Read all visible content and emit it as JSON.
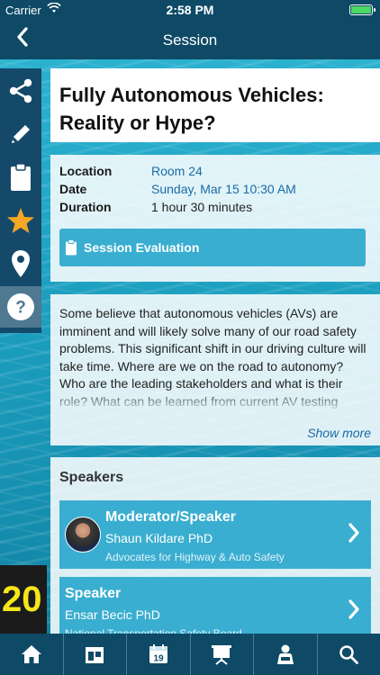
{
  "status_bar": {
    "carrier": "Carrier",
    "time": "2:58 PM"
  },
  "nav": {
    "title": "Session",
    "back_icon": "chevron-left-icon"
  },
  "sidebar": {
    "items": [
      {
        "icon": "share-icon"
      },
      {
        "icon": "pencil-icon"
      },
      {
        "icon": "clipboard-icon"
      },
      {
        "icon": "star-icon",
        "color": "#f5a623"
      },
      {
        "icon": "map-pin-icon"
      },
      {
        "icon": "help-icon",
        "active": true
      }
    ]
  },
  "session": {
    "title": "Fully Autonomous Vehicles: Reality or Hype?",
    "location_label": "Location",
    "location": "Room 24",
    "date_label": "Date",
    "date": "Sunday, Mar 15 10:30 AM",
    "duration_label": "Duration",
    "duration": "1 hour 30 minutes",
    "evaluation_label": "Session Evaluation",
    "description": "Some believe that autonomous vehicles (AVs) are imminent and will likely solve many of our road safety problems. This significant shift in our driving culture will take time. Where are we on the road to autonomy? Who are the leading stakeholders and what is their role? What can be learned from current AV testing programs and current legislative activities?",
    "show_more": "Show more"
  },
  "speakers": {
    "heading": "Speakers",
    "list": [
      {
        "role": "Moderator/Speaker",
        "name": "Shaun Kildare PhD",
        "org": "Advocates for Highway & Auto Safety"
      },
      {
        "role": "Speaker",
        "name": "Ensar Becic PhD",
        "org": "National Transportation Safety Board"
      }
    ]
  },
  "background": {
    "year_fragment": "20"
  },
  "tabbar": {
    "items": [
      {
        "icon": "home-icon"
      },
      {
        "icon": "exhibitor-booth-icon"
      },
      {
        "icon": "calendar-icon",
        "day": "19"
      },
      {
        "icon": "presentation-icon"
      },
      {
        "icon": "speaker-person-icon"
      },
      {
        "icon": "search-icon"
      }
    ]
  },
  "colors": {
    "nav_bg": "#0e4a66",
    "accent": "#3aaed0",
    "link": "#1b6aa8",
    "star": "#f5a623"
  }
}
